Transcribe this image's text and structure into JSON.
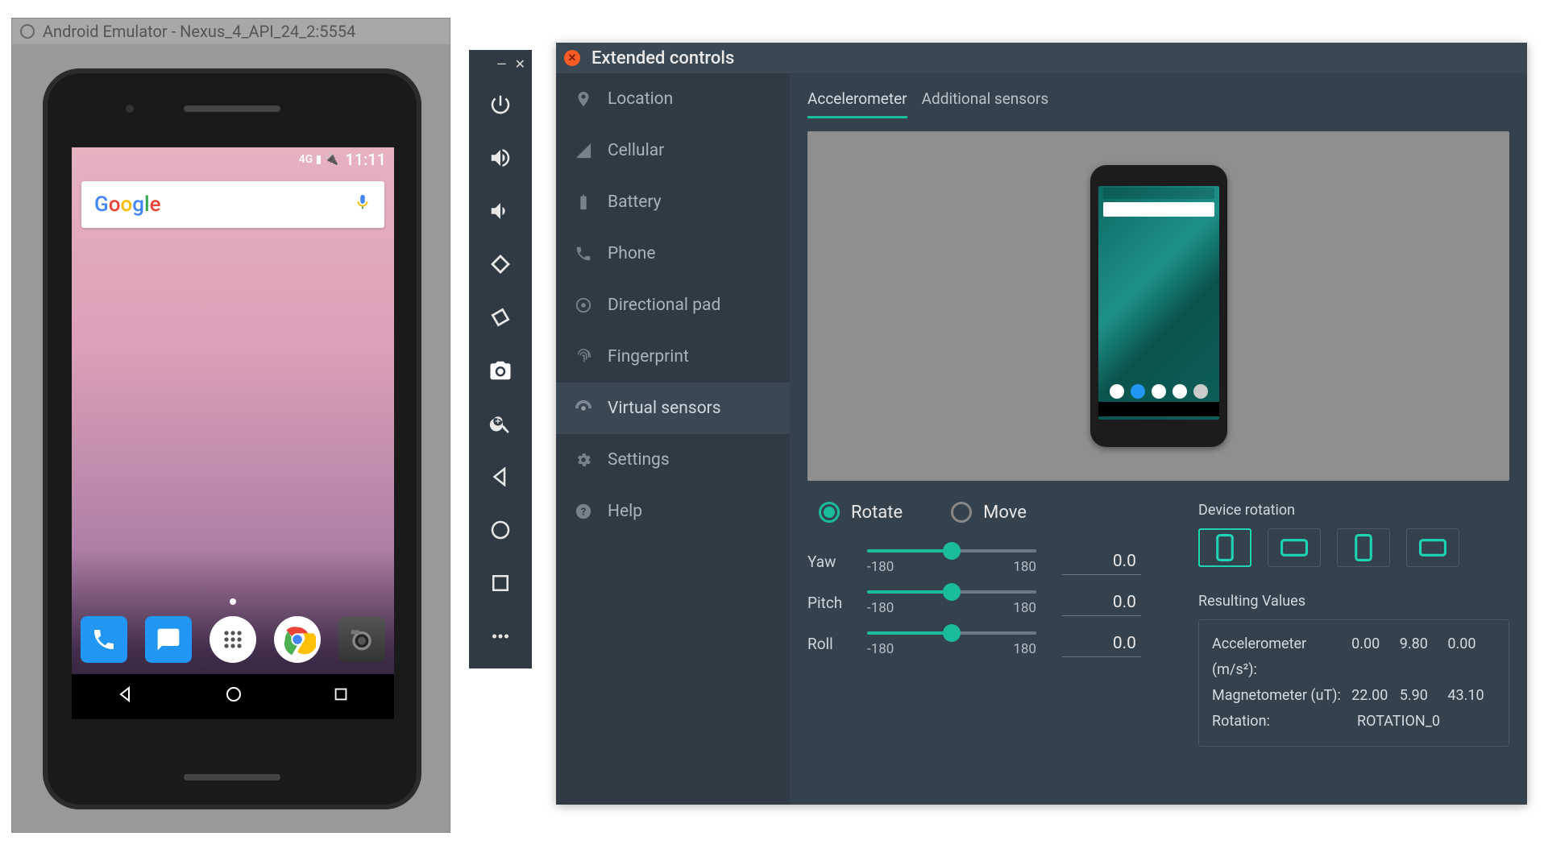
{
  "emulator": {
    "window_title": "Android Emulator - Nexus_4_API_24_2:5554",
    "status_time": "11:11",
    "status_icons": "4G ▮ 🔌",
    "dock": [
      "phone",
      "messages",
      "apps",
      "chrome",
      "camera"
    ],
    "nav": [
      "back",
      "home",
      "recents"
    ]
  },
  "toolbar_items": [
    "power",
    "volume-up",
    "volume-down",
    "rotate-left",
    "rotate-right",
    "screenshot",
    "zoom",
    "back",
    "home",
    "overview",
    "more"
  ],
  "extended": {
    "title": "Extended controls",
    "sidebar": [
      {
        "icon": "location",
        "label": "Location"
      },
      {
        "icon": "cellular",
        "label": "Cellular"
      },
      {
        "icon": "battery",
        "label": "Battery"
      },
      {
        "icon": "phone",
        "label": "Phone"
      },
      {
        "icon": "dpad",
        "label": "Directional pad"
      },
      {
        "icon": "fingerprint",
        "label": "Fingerprint"
      },
      {
        "icon": "sensors",
        "label": "Virtual sensors"
      },
      {
        "icon": "settings",
        "label": "Settings"
      },
      {
        "icon": "help",
        "label": "Help"
      }
    ],
    "active_sidebar": "Virtual sensors",
    "tabs": {
      "accelerometer": "Accelerometer",
      "additional": "Additional sensors",
      "active": "Accelerometer"
    },
    "mode": {
      "rotate": "Rotate",
      "move": "Move",
      "selected": "Rotate"
    },
    "sliders": {
      "yaw": {
        "label": "Yaw",
        "min": "-180",
        "max": "180",
        "value": "0.0",
        "pos": 50
      },
      "pitch": {
        "label": "Pitch",
        "min": "-180",
        "max": "180",
        "value": "0.0",
        "pos": 50
      },
      "roll": {
        "label": "Roll",
        "min": "-180",
        "max": "180",
        "value": "0.0",
        "pos": 50
      }
    },
    "device_rotation_label": "Device rotation",
    "resulting_label": "Resulting Values",
    "resulting": {
      "accel_label": "Accelerometer (m/s²):",
      "accel": [
        "0.00",
        "9.80",
        "0.00"
      ],
      "mag_label": "Magnetometer (uT):",
      "mag": [
        "22.00",
        "5.90",
        "43.10"
      ],
      "rot_label": "Rotation:",
      "rot": "ROTATION_0"
    }
  }
}
